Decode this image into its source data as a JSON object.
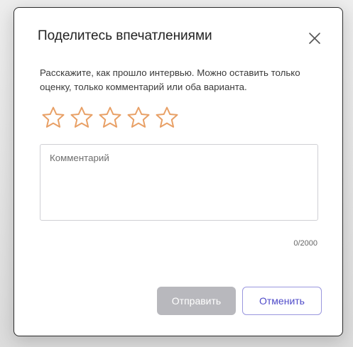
{
  "modal": {
    "title": "Поделитесь впечатлениями",
    "description": "Расскажите, как прошло интервью. Можно оставить только оценку, только комментарий или оба варианта.",
    "rating": {
      "max": 5,
      "value": 0,
      "star_icon": "star-outline-icon",
      "star_color": "#e8a066"
    },
    "comment": {
      "placeholder": "Комментарий",
      "value": ""
    },
    "counter": "0/2000",
    "buttons": {
      "submit_label": "Отправить",
      "cancel_label": "Отменить"
    },
    "colors": {
      "submit_disabled_bg": "#b8b8bd",
      "cancel_text": "#4f4bc9",
      "cancel_border": "#9a97de"
    }
  }
}
